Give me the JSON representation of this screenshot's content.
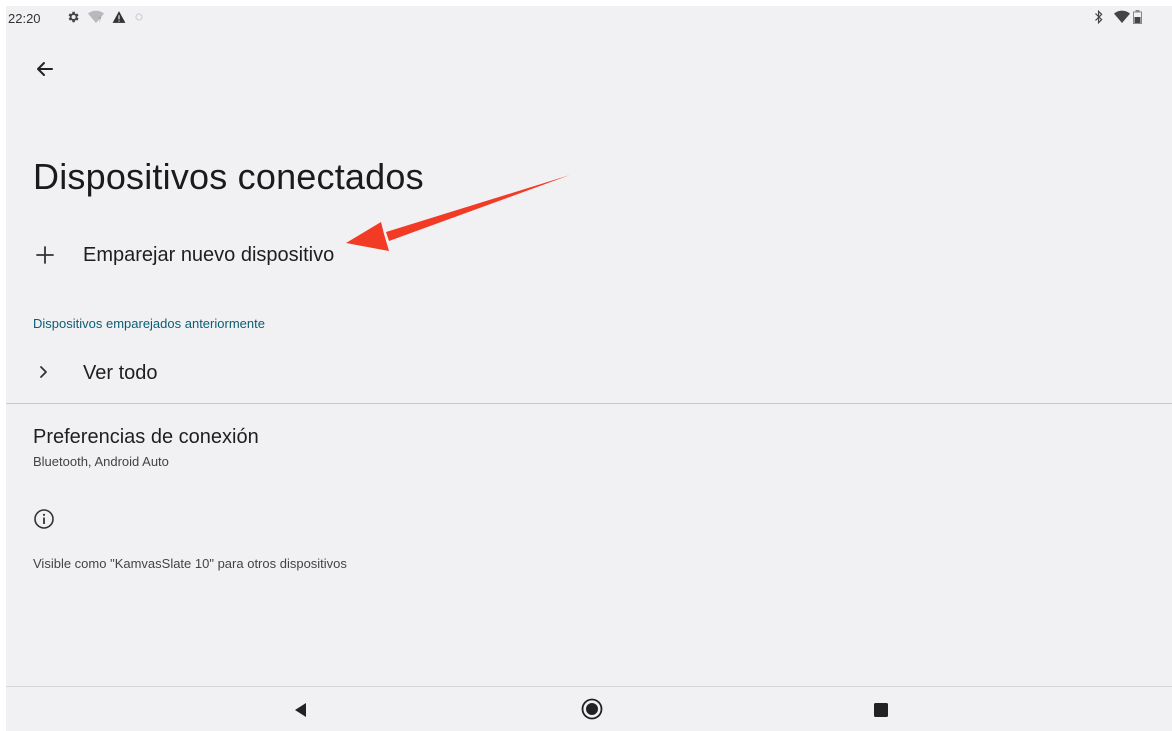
{
  "status_bar": {
    "time": "22:20",
    "left_icons": [
      "gear-icon",
      "wifi-question-icon",
      "warning-icon",
      "dim-icon"
    ],
    "right_icons": [
      "bluetooth-icon",
      "wifi-icon",
      "battery-icon"
    ]
  },
  "header": {
    "back_icon": "arrow-back-icon",
    "title": "Dispositivos conectados"
  },
  "pair_new": {
    "icon": "plus-icon",
    "label": "Emparejar nuevo dispositivo"
  },
  "previously_paired": {
    "section_title": "Dispositivos emparejados anteriormente",
    "see_all_icon": "chevron-right-icon",
    "see_all_label": "Ver todo"
  },
  "connection_preferences": {
    "title": "Preferencias de conexión",
    "subtitle": "Bluetooth, Android Auto"
  },
  "footer_info": {
    "icon": "info-icon",
    "text": "Visible como \"KamvasSlate 10\" para otros dispositivos"
  },
  "nav_bar": {
    "buttons": [
      "back-triangle-icon",
      "home-circle-icon",
      "recents-square-icon"
    ]
  },
  "colors": {
    "background": "#f1f1f3",
    "section_accent": "#0b5e73",
    "annotation_arrow": "#f23b24"
  }
}
